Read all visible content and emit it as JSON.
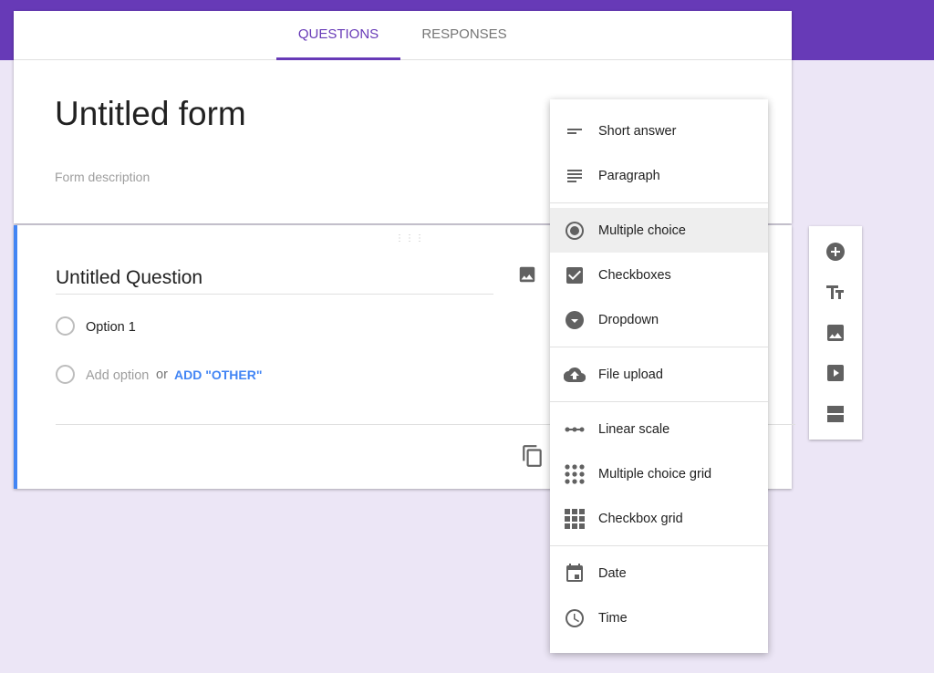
{
  "colors": {
    "accent": "#673ab7",
    "link": "#4285f4",
    "background": "#ece6f6"
  },
  "tabs": [
    {
      "label": "QUESTIONS",
      "active": true
    },
    {
      "label": "RESPONSES",
      "active": false
    }
  ],
  "form": {
    "title": "Untitled form",
    "description_placeholder": "Form description"
  },
  "question": {
    "title": "Untitled Question",
    "options": [
      "Option 1"
    ],
    "add_option": "Add option",
    "or": "or",
    "add_other": "ADD \"OTHER\""
  },
  "menu": {
    "items": [
      {
        "label": "Short answer",
        "icon": "short-text-icon"
      },
      {
        "label": "Paragraph",
        "icon": "paragraph-icon"
      },
      {
        "label": "Multiple choice",
        "icon": "radio-icon",
        "selected": true
      },
      {
        "label": "Checkboxes",
        "icon": "checkbox-icon"
      },
      {
        "label": "Dropdown",
        "icon": "dropdown-icon"
      },
      {
        "label": "File upload",
        "icon": "cloud-upload-icon"
      },
      {
        "label": "Linear scale",
        "icon": "linear-scale-icon"
      },
      {
        "label": "Multiple choice grid",
        "icon": "dot-grid-icon"
      },
      {
        "label": "Checkbox grid",
        "icon": "square-grid-icon"
      },
      {
        "label": "Date",
        "icon": "calendar-icon"
      },
      {
        "label": "Time",
        "icon": "clock-icon"
      }
    ]
  },
  "side_toolbar": [
    "add-question-icon",
    "add-title-icon",
    "add-image-icon",
    "add-video-icon",
    "add-section-icon"
  ]
}
